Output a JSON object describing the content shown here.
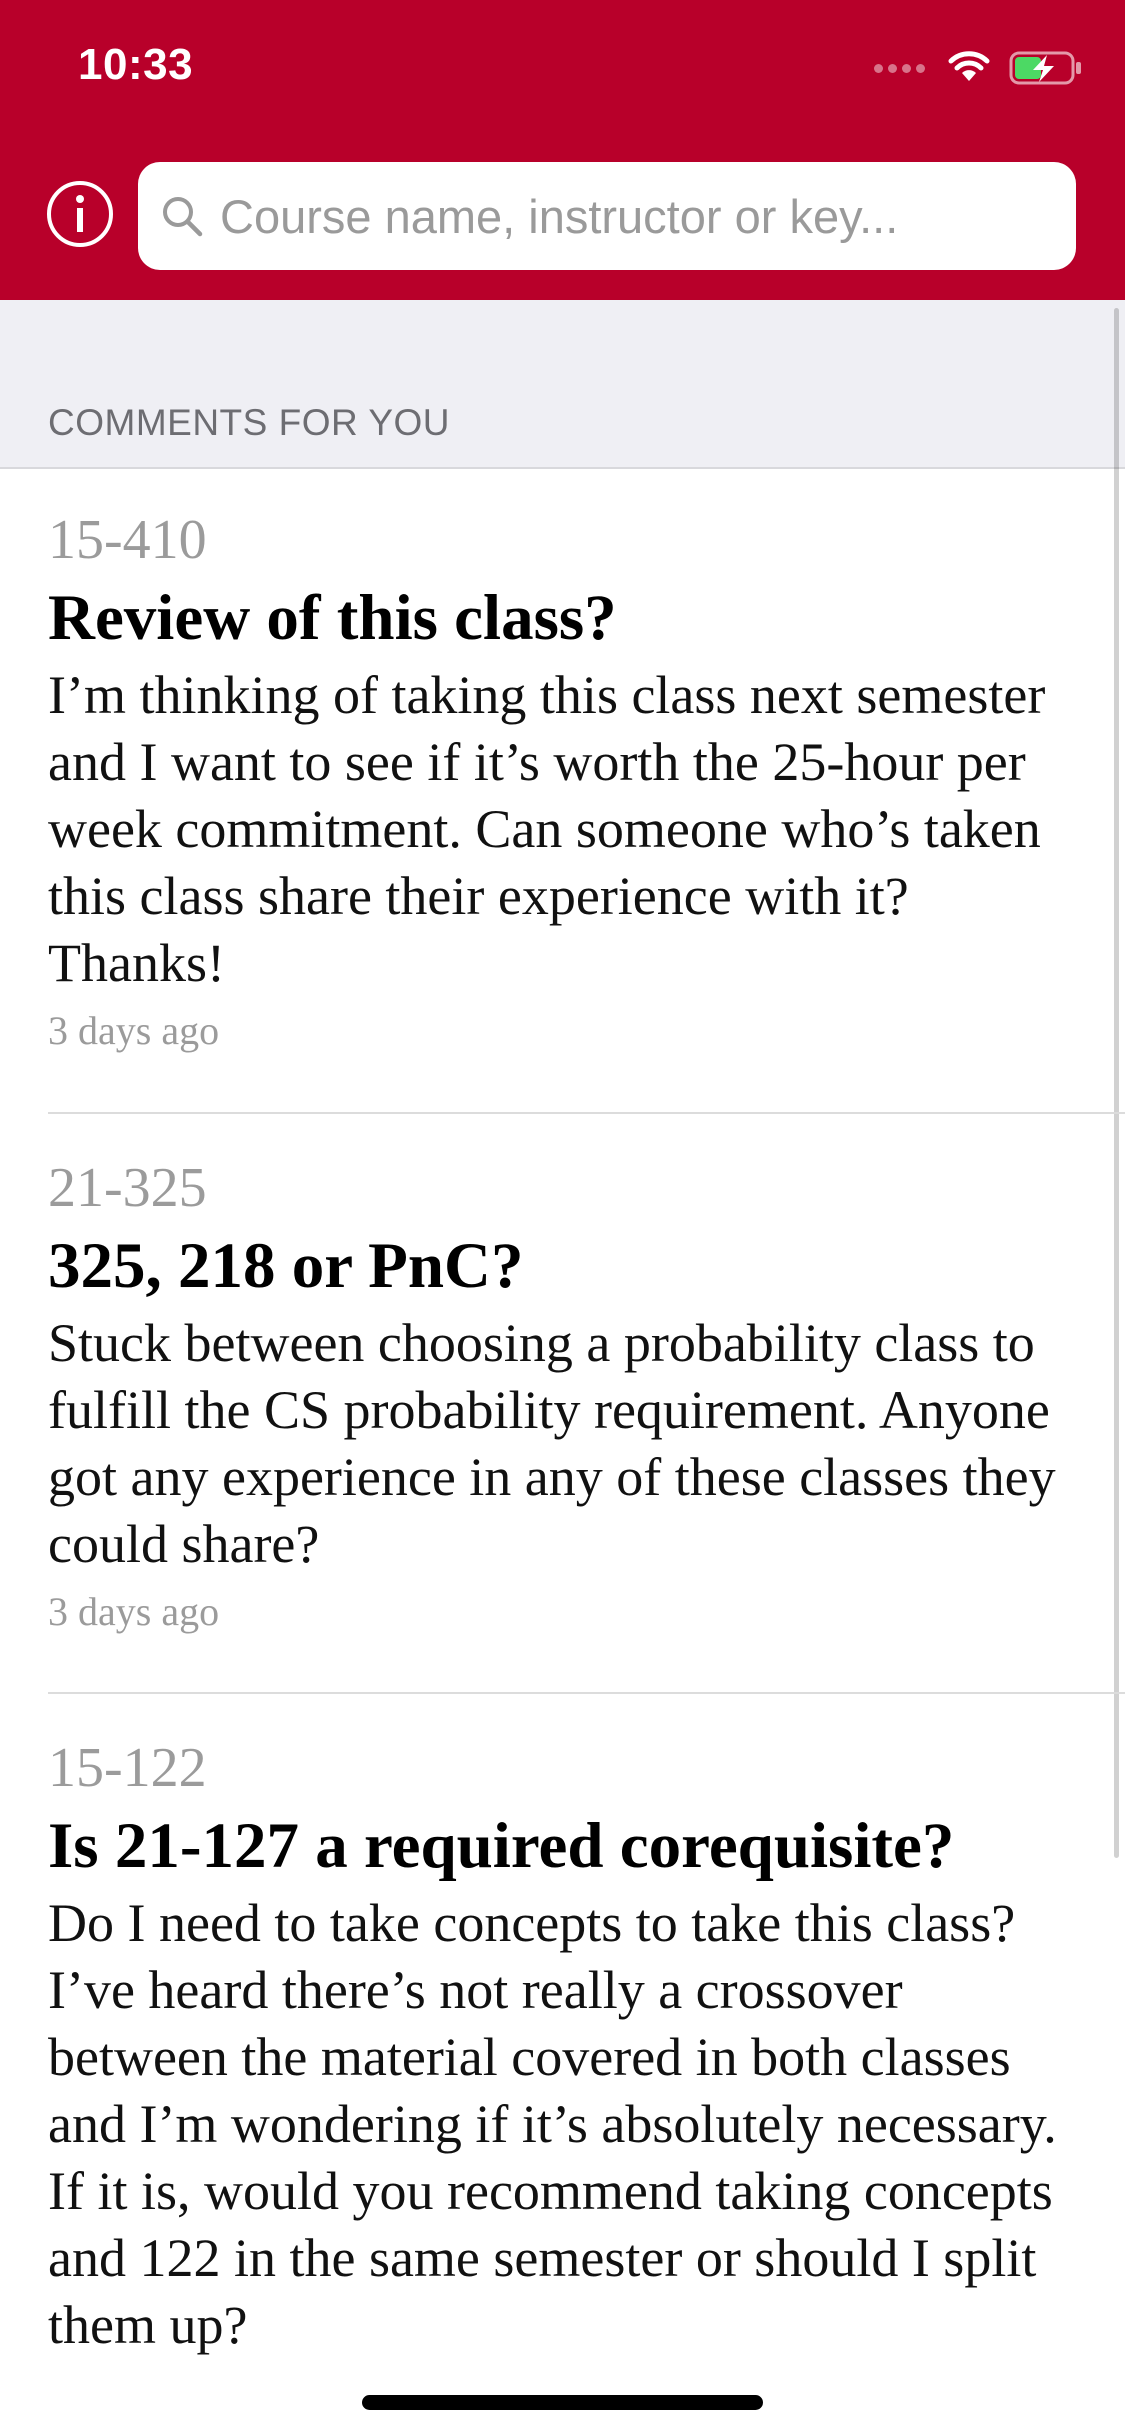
{
  "status_bar": {
    "time": "10:33"
  },
  "search": {
    "placeholder": "Course name, instructor or key..."
  },
  "section": {
    "title": "COMMENTS FOR YOU"
  },
  "comments": [
    {
      "course_key": "15-410",
      "title": "Review of this class?",
      "body": "I’m thinking of taking this class next semester and I want to see if it’s worth the 25-hour per week commitment.  Can someone who’s taken this class share their experience with it?  Thanks!",
      "time": "3 days ago"
    },
    {
      "course_key": "21-325",
      "title": "325, 218 or PnC?",
      "body": "Stuck between choosing a probability class to fulfill the CS probability requirement. Anyone got any experience in any of these classes they could share?",
      "time": "3 days ago"
    },
    {
      "course_key": "15-122",
      "title": "Is 21-127 a required corequisite?",
      "body": "Do I need to take concepts to take this class?  I’ve heard there’s not really a crossover between the material covered in both classes and I’m wondering if it’s absolutely necessary.  If it is, would you recommend taking concepts and 122 in the same semester or should I split them up?"
    }
  ],
  "colors": {
    "brand": "#B8002A",
    "section_background": "#EFEFF4",
    "secondary_text": "#9B9B9B"
  },
  "icons": {
    "info": "info-circle-icon",
    "search": "magnifying-glass-icon",
    "wifi": "wifi-icon",
    "battery": "battery-charging-icon"
  }
}
